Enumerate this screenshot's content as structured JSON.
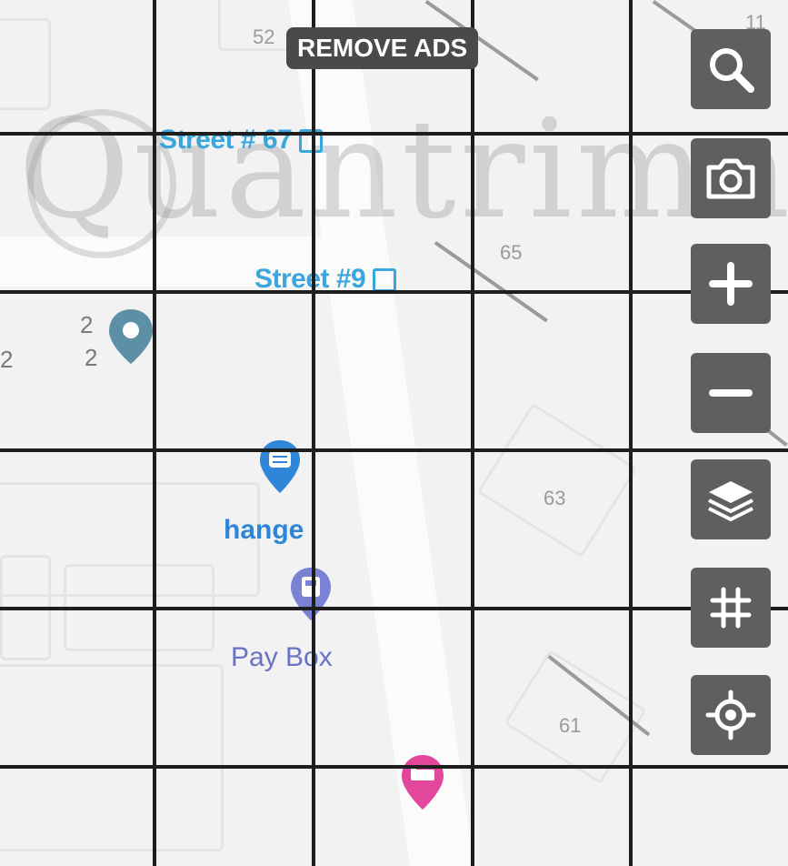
{
  "map": {
    "house_numbers": [
      "52",
      "11",
      "65",
      "63",
      "61",
      "2",
      "2",
      "2"
    ],
    "streets": [
      {
        "name": "Street # 67"
      },
      {
        "name": "Street #9"
      }
    ],
    "pois": [
      {
        "label": "hange",
        "color": "#2f86d8",
        "icon": "exchange-icon"
      },
      {
        "label": "Pay Box",
        "color": "#7b82d6",
        "icon": "paybox-icon"
      },
      {
        "label": "",
        "color": "#e2479b",
        "icon": "hotel-icon"
      },
      {
        "label": "",
        "color": "#5d8fa6",
        "icon": "location-icon"
      }
    ],
    "watermark": "Quantrimang"
  },
  "ads": {
    "remove_label": "REMOVE ADS"
  },
  "controls": [
    {
      "icon": "search-icon"
    },
    {
      "icon": "camera-icon"
    },
    {
      "icon": "zoom-in-icon"
    },
    {
      "icon": "zoom-out-icon"
    },
    {
      "icon": "layers-icon"
    },
    {
      "icon": "grid-icon"
    },
    {
      "icon": "my-location-icon"
    }
  ],
  "colors": {
    "control_bg": "#5f5f5f",
    "street_label": "#3aa6dd",
    "grid": "#1e1e1e"
  }
}
